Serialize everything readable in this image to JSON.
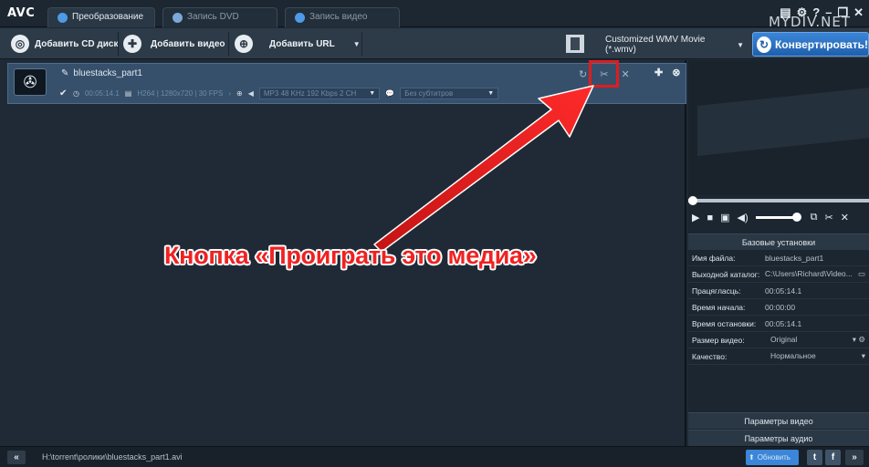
{
  "app": {
    "logo": "AVC",
    "watermark": "MYDIV.NET"
  },
  "tabs": [
    {
      "label": "Преобразование",
      "active": true
    },
    {
      "label": "Запись DVD",
      "active": false
    },
    {
      "label": "Запись видео",
      "active": false
    }
  ],
  "toolbar": {
    "add_cd": "Добавить CD диск",
    "add_video": "Добавить видео",
    "add_url": "Добавить URL",
    "format": "Customized WMV Movie (*.wmv)",
    "convert": "Конвертировать!"
  },
  "file": {
    "name": "bluestacks_part1",
    "duration": "00:05:14.1",
    "video_info": "H264 | 1280x720 | 30 FPS",
    "audio_track": "MP3 48 KHz 192 Kbps 2 CH",
    "subtitles": "Без субтитров"
  },
  "annotation": {
    "text": "Кнопка «Проиграть это медиа»"
  },
  "properties": {
    "header": "Базовые установки",
    "rows": [
      {
        "key": "Имя файла:",
        "value": "bluestacks_part1"
      },
      {
        "key": "Выходной каталог:",
        "value": "C:\\Users\\Richard\\Video..."
      },
      {
        "key": "Працягласць:",
        "value": "00:05:14.1"
      },
      {
        "key": "Время начала:",
        "value": "00:00:00"
      },
      {
        "key": "Время остановки:",
        "value": "00:05:14.1"
      },
      {
        "key": "Размер видео:",
        "value": "Original"
      },
      {
        "key": "Качество:",
        "value": "Нормальное"
      }
    ],
    "video_params": "Параметры видео",
    "audio_params": "Параметры аудио"
  },
  "status": {
    "path": "H:\\torrent\\ролики\\bluestacks_part1.avi",
    "update": "Обновить"
  },
  "colors": {
    "accent": "#3b86d8",
    "row_bg": "#36506c",
    "annotation": "#ef2222"
  }
}
